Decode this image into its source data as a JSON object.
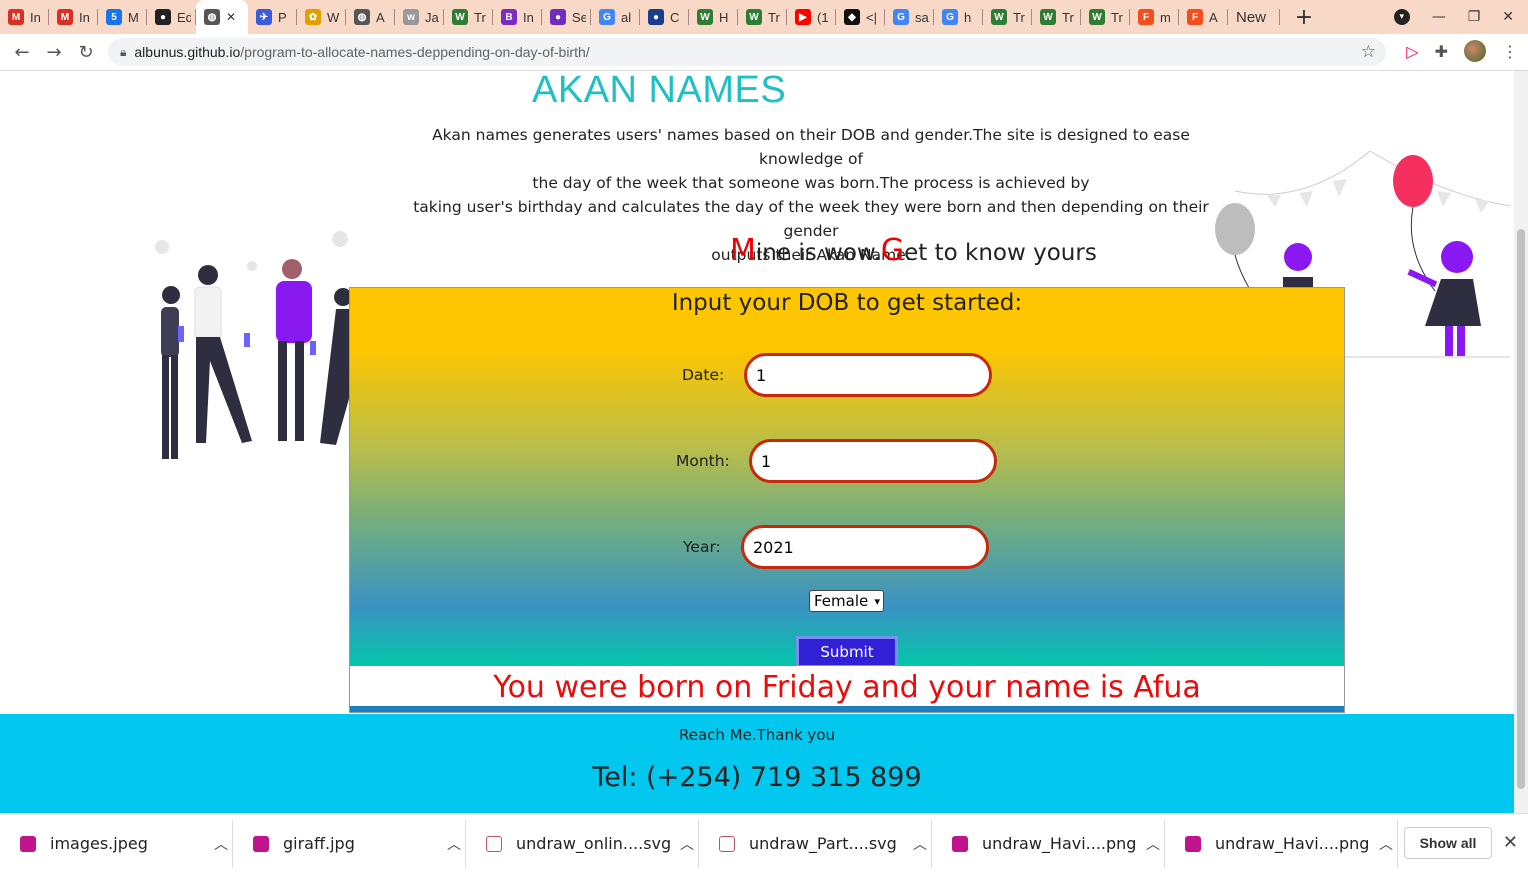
{
  "browser": {
    "tabs": [
      {
        "label": "In",
        "icon": "gmail-icon",
        "color": "#d93025",
        "glyph": "M"
      },
      {
        "label": "In",
        "icon": "gmail-icon",
        "color": "#d93025",
        "glyph": "M"
      },
      {
        "label": "M",
        "icon": "calendar-icon",
        "color": "#1a73e8",
        "glyph": "5"
      },
      {
        "label": "Ed",
        "icon": "github-icon",
        "color": "#222",
        "glyph": "●"
      },
      {
        "label": "P",
        "icon": "bird-icon",
        "color": "#3b5bdb",
        "glyph": "✈"
      },
      {
        "label": "W",
        "icon": "flower-icon",
        "color": "#e0a000",
        "glyph": "✿"
      },
      {
        "label": "A",
        "icon": "globe-icon",
        "color": "#555",
        "glyph": "◍"
      },
      {
        "label": "Ja",
        "icon": "w3schools-icon",
        "color": "#999",
        "glyph": "w"
      },
      {
        "label": "Tr",
        "icon": "wordpress-icon",
        "color": "#2e7d32",
        "glyph": "W"
      },
      {
        "label": "In",
        "icon": "bootstrap-icon",
        "color": "#7b2cbf",
        "glyph": "B"
      },
      {
        "label": "Se",
        "icon": "circle-icon",
        "color": "#6f2dbd",
        "glyph": "●"
      },
      {
        "label": "al",
        "icon": "google-icon",
        "color": "#4285f4",
        "glyph": "G"
      },
      {
        "label": "C",
        "icon": "circle-icon",
        "color": "#1a3c8c",
        "glyph": "●"
      },
      {
        "label": "H",
        "icon": "wordpress-icon",
        "color": "#2e7d32",
        "glyph": "W"
      },
      {
        "label": "Tr",
        "icon": "wordpress-icon",
        "color": "#2e7d32",
        "glyph": "W"
      },
      {
        "label": "(1",
        "icon": "youtube-icon",
        "color": "#ff0000",
        "glyph": "▶"
      },
      {
        "label": "<|",
        "icon": "codepen-icon",
        "color": "#111",
        "glyph": "◆"
      },
      {
        "label": "sa",
        "icon": "google-icon",
        "color": "#4285f4",
        "glyph": "G"
      },
      {
        "label": "h",
        "icon": "google-icon",
        "color": "#4285f4",
        "glyph": "G"
      },
      {
        "label": "Tr",
        "icon": "wordpress-icon",
        "color": "#2e7d32",
        "glyph": "W"
      },
      {
        "label": "Tr",
        "icon": "wordpress-icon",
        "color": "#2e7d32",
        "glyph": "W"
      },
      {
        "label": "Tr",
        "icon": "wordpress-icon",
        "color": "#2e7d32",
        "glyph": "W"
      },
      {
        "label": "m",
        "icon": "figma-icon",
        "color": "#f24e1e",
        "glyph": "F"
      },
      {
        "label": "A",
        "icon": "figma-icon",
        "color": "#f24e1e",
        "glyph": "F"
      }
    ],
    "active_tab": {
      "label": "",
      "close": "✕"
    },
    "new_tab_label": "New",
    "url_host": "albunus.github.io",
    "url_path": "/program-to-allocate-names-deppending-on-day-of-birth/"
  },
  "page": {
    "title": "AKAN NAMES",
    "description_lines": [
      "Akan names generates users' names based on their DOB and gender.The site is designed to ease knowledge of",
      "the day of the week that someone was born.The process is achieved by",
      "taking user's birthday and calculates the day of the week they were born and then depending on their gender",
      "outputs their Akan Name."
    ],
    "tagline": {
      "cap1": "M",
      "part1": "ine is wow.",
      "cap2": "G",
      "part2": "et to know yours"
    },
    "form": {
      "prompt": "Input your DOB to get started:",
      "date_label": "Date:",
      "date_value": "1",
      "month_label": "Month:",
      "month_value": "1",
      "year_label": "Year:",
      "year_value": "2021",
      "gender_selected": "Female",
      "submit_label": "Submit",
      "result": "You were born on Friday and your name is Afua"
    },
    "footer": {
      "reach": "Reach Me.Thank you",
      "tel": "Tel: (+254) 719 315 899"
    }
  },
  "downloads": {
    "items": [
      {
        "name": "images.jpeg",
        "type": "image"
      },
      {
        "name": "giraff.jpg",
        "type": "image"
      },
      {
        "name": "undraw_onlin....svg",
        "type": "svg"
      },
      {
        "name": "undraw_Part....svg",
        "type": "svg"
      },
      {
        "name": "undraw_Havi....png",
        "type": "image"
      },
      {
        "name": "undraw_Havi....png",
        "type": "image"
      }
    ],
    "show_all": "Show all"
  },
  "colors": {
    "title": "#1fc0c3",
    "accent_red": "#e80c0c",
    "submit_bg": "#3120d6",
    "footer_bg": "#02c8ef",
    "input_border": "#c8280c"
  }
}
